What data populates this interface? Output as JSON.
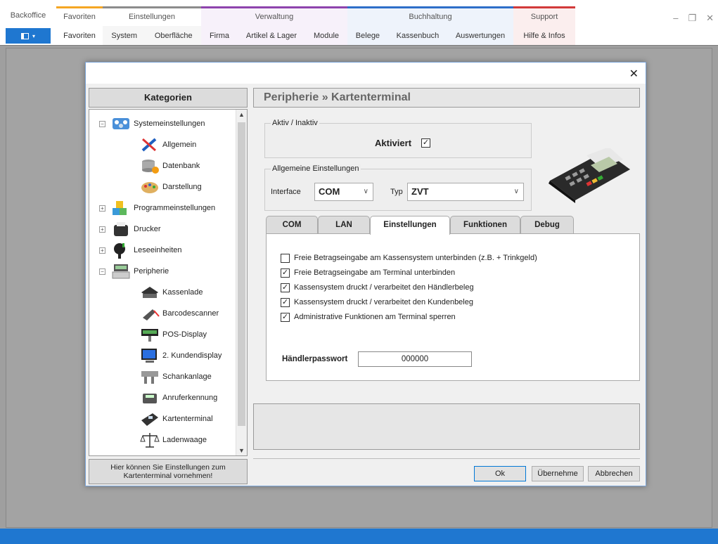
{
  "ribbon": {
    "backoffice": "Backoffice",
    "groups": [
      {
        "title": "Favoriten",
        "color": "#f5a623",
        "items": [
          "Favoriten"
        ]
      },
      {
        "title": "Einstellungen",
        "color": "#8c8c8c",
        "items": [
          "System",
          "Oberfläche"
        ]
      },
      {
        "title": "Verwaltung",
        "color": "#8e44ad",
        "items": [
          "Firma",
          "Artikel & Lager",
          "Module"
        ]
      },
      {
        "title": "Buchhaltung",
        "color": "#2e6fc9",
        "items": [
          "Belege",
          "Kassenbuch",
          "Auswertungen"
        ]
      },
      {
        "title": "Support",
        "color": "#d23a3a",
        "items": [
          "Hilfe & Infos"
        ]
      }
    ],
    "menu_icon": "grid-icon",
    "window_controls": {
      "minimize": "–",
      "restore": "❐",
      "close": "✕"
    }
  },
  "dialog": {
    "close": "✕",
    "categories_title": "Kategorien",
    "tree": [
      {
        "label": "Systemeinstellungen",
        "toggle": "⊟",
        "icon": "network-icon"
      },
      {
        "label": "Allgemein",
        "icon": "tools-icon"
      },
      {
        "label": "Datenbank",
        "icon": "database-icon"
      },
      {
        "label": "Darstellung",
        "icon": "palette-icon"
      },
      {
        "label": "Programmeinstellungen",
        "toggle": "⊞",
        "icon": "cubes-icon"
      },
      {
        "label": "Drucker",
        "toggle": "⊞",
        "icon": "printer-icon"
      },
      {
        "label": "Leseeinheiten",
        "toggle": "⊞",
        "icon": "reader-icon"
      },
      {
        "label": "Peripherie",
        "toggle": "⊟",
        "icon": "register-icon"
      },
      {
        "label": "Kassenlade",
        "icon": "cash-drawer-icon"
      },
      {
        "label": "Barcodescanner",
        "icon": "scanner-icon"
      },
      {
        "label": "POS-Display",
        "icon": "pos-display-icon"
      },
      {
        "label": "2. Kundendisplay",
        "icon": "monitor-icon"
      },
      {
        "label": "Schankanlage",
        "icon": "tap-icon"
      },
      {
        "label": "Anruferkennung",
        "icon": "phone-icon"
      },
      {
        "label": "Kartenterminal",
        "icon": "card-terminal-icon"
      },
      {
        "label": "Ladenwaage",
        "icon": "scale-icon"
      }
    ],
    "info": "Hier können Sie Einstellungen zum Kartenterminal vornehmen!",
    "page_title": "Peripherie » Kartenterminal",
    "active_group": "Aktiv / Inaktiv",
    "activated_label": "Aktiviert",
    "activated_checked": "☑",
    "general_group": "Allgemeine Einstellungen",
    "interface_label": "Interface",
    "interface_value": "COM",
    "type_label": "Typ",
    "type_value": "ZVT",
    "tabs": [
      "COM",
      "LAN",
      "Einstellungen",
      "Funktionen",
      "Debug"
    ],
    "active_tab": "Einstellungen",
    "options": [
      {
        "label": "Freie Betragseingabe am Kassensystem unterbinden (z.B. + Trinkgeld)",
        "mark": ""
      },
      {
        "label": "Freie Betragseingabe am Terminal unterbinden",
        "mark": "✓"
      },
      {
        "label": "Kassensystem druckt / verarbeitet den Händlerbeleg",
        "mark": "✓"
      },
      {
        "label": "Kassensystem druckt / verarbeitet den Kundenbeleg",
        "mark": "✓"
      },
      {
        "label": "Administrative Funktionen am Terminal sperren",
        "mark": "✓"
      }
    ],
    "password_label": "Händlerpasswort",
    "password_value": "000000",
    "buttons": {
      "ok": "Ok",
      "apply": "Übernehme",
      "cancel": "Abbrechen"
    }
  },
  "colors": {
    "accent": "#1f77d0",
    "desktop": "#a3a3a3"
  }
}
